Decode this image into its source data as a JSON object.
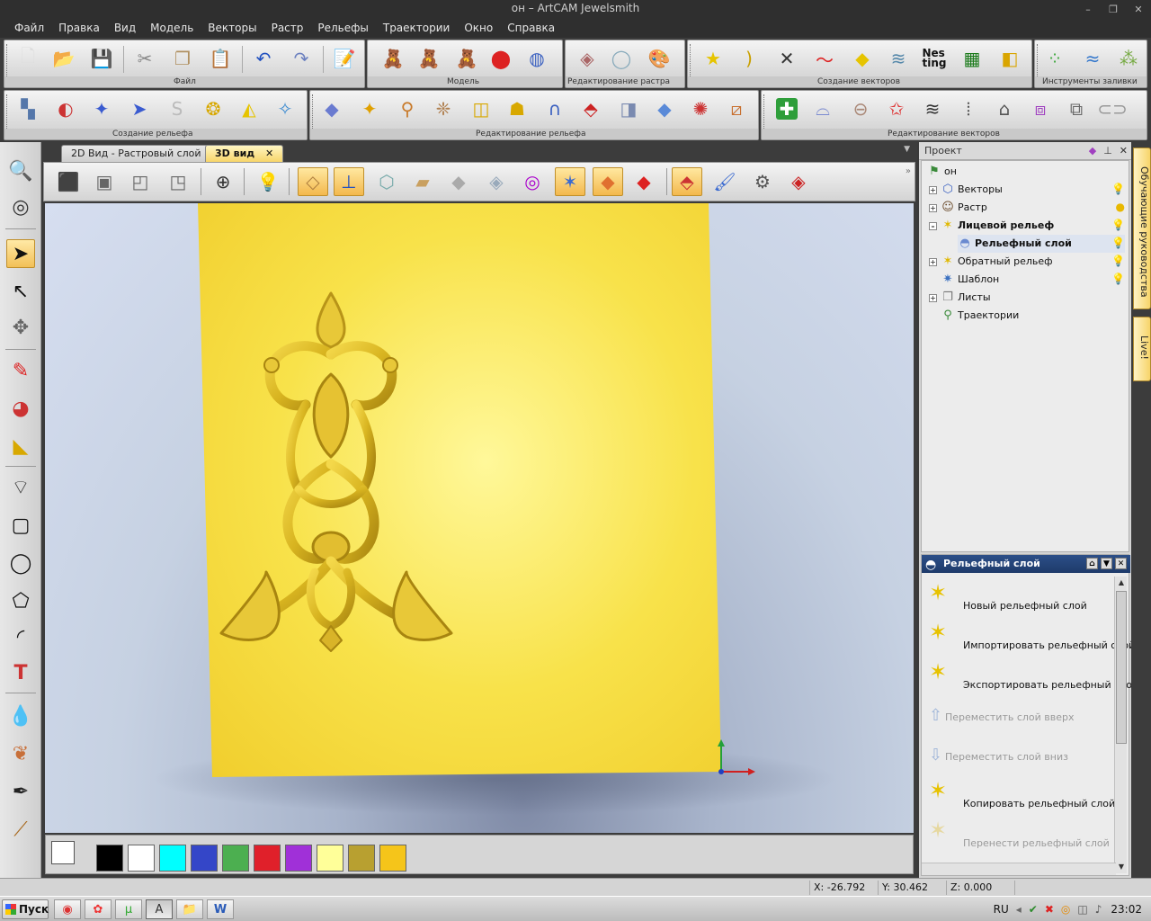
{
  "window": {
    "title": "он – ArtCAM Jewelsmith",
    "buttons": [
      "–",
      "❐",
      "✕"
    ]
  },
  "menu": [
    "Файл",
    "Правка",
    "Вид",
    "Модель",
    "Векторы",
    "Растр",
    "Рельефы",
    "Траектории",
    "Окно",
    "Справка"
  ],
  "toolbars": {
    "row1_groups": [
      "Файл",
      "Модель",
      "Редактирование растра",
      "Создание векторов",
      "Инструменты заливки"
    ],
    "row2_groups": [
      "Создание рельефа",
      "Редактирование рельефа",
      "Редактирование векторов"
    ],
    "nesting_label": "Nes\nting"
  },
  "tabs": [
    {
      "label": "2D Вид - Растровый слой",
      "active": false
    },
    {
      "label": "3D вид",
      "active": true,
      "close": "✕"
    }
  ],
  "project": {
    "title": "Проект",
    "root": "он",
    "items": [
      {
        "label": "Векторы",
        "level": 1,
        "expander": "+",
        "icon": "vectors-icon",
        "bold": false
      },
      {
        "label": "Растр",
        "level": 1,
        "expander": "+",
        "icon": "raster-icon",
        "bold": false
      },
      {
        "label": "Лицевой рельеф",
        "level": 1,
        "expander": "–",
        "icon": "relief-icon",
        "bold": true
      },
      {
        "label": "Рельефный слой",
        "level": 2,
        "expander": "",
        "icon": "relief-layer-icon",
        "bold": true
      },
      {
        "label": "Обратный рельеф",
        "level": 1,
        "expander": "+",
        "icon": "back-relief-icon",
        "bold": false
      },
      {
        "label": "Шаблон",
        "level": 1,
        "expander": "",
        "icon": "template-icon",
        "bold": false
      },
      {
        "label": "Листы",
        "level": 1,
        "expander": "+",
        "icon": "sheets-icon",
        "bold": false
      },
      {
        "label": "Траектории",
        "level": 1,
        "expander": "",
        "icon": "toolpaths-icon",
        "bold": false
      }
    ]
  },
  "relief_layer_panel": {
    "title": "Рельефный слой",
    "actions": [
      {
        "label": "Новый рельефный слой",
        "enabled": true
      },
      {
        "label": "Импортировать рельефный слой",
        "enabled": true
      },
      {
        "label": "Экспортировать рельефный слой",
        "enabled": true
      },
      {
        "label": "Переместить слой вверх",
        "enabled": false
      },
      {
        "label": "Переместить слой вниз",
        "enabled": false
      },
      {
        "label": "Копировать рельефный слой",
        "enabled": true
      },
      {
        "label": "Перенести рельефный слой",
        "enabled": false
      }
    ]
  },
  "side_tabs": [
    "Обучающие руководства",
    "Live!"
  ],
  "palette": [
    "#000000",
    "#ffffff",
    "#00ffff",
    "#3446c8",
    "#4caf50",
    "#e0202a",
    "#a030d8",
    "#ffff99",
    "#b8a030",
    "#f5c51a"
  ],
  "status": {
    "x": "X: -26.792",
    "y": "Y: 30.462",
    "z": "Z: 0.000"
  },
  "taskbar": {
    "start": "Пуск",
    "lang": "RU",
    "time": "23:02"
  },
  "colors": {
    "accent_header": "#1e3a6a",
    "relief_gold": "#f5d84a",
    "tab_active": "#f7d56a"
  }
}
